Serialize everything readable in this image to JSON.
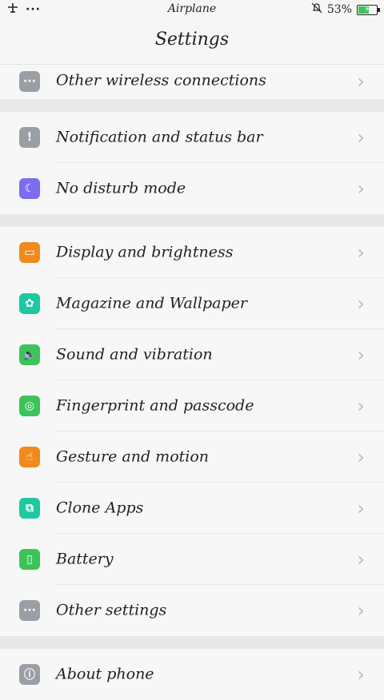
{
  "status_bar": {
    "left_icons": [
      "airplane-icon",
      "more-dots-icon"
    ],
    "center_text": "Airplane",
    "battery_percent": "53%",
    "battery_level": 0.53,
    "battery_color": "#3cc35a"
  },
  "header": {
    "title": "Settings"
  },
  "sections": [
    {
      "items": [
        {
          "label": "Other wireless connections",
          "icon": "more-dots-icon",
          "color": "#9a9fa6",
          "glyph": "···"
        }
      ]
    },
    {
      "items": [
        {
          "label": "Notification and status bar",
          "icon": "exclamation-icon",
          "color": "#9a9fa6",
          "glyph": "!"
        },
        {
          "label": "No disturb mode",
          "icon": "moon-icon",
          "color": "#7b6cf0",
          "glyph": "☾"
        }
      ]
    },
    {
      "items": [
        {
          "label": "Display and brightness",
          "icon": "monitor-icon",
          "color": "#f08a1d",
          "glyph": "▭"
        },
        {
          "label": "Magazine and Wallpaper",
          "icon": "pinwheel-icon",
          "color": "#1ec8a0",
          "glyph": "✿"
        },
        {
          "label": "Sound and vibration",
          "icon": "speaker-icon",
          "color": "#3cc35a",
          "glyph": "🔈"
        },
        {
          "label": "Fingerprint and passcode",
          "icon": "fingerprint-icon",
          "color": "#3cc35a",
          "glyph": "◎"
        },
        {
          "label": "Gesture and motion",
          "icon": "hand-icon",
          "color": "#f08a1d",
          "glyph": "☝"
        },
        {
          "label": "Clone Apps",
          "icon": "clone-icon",
          "color": "#1ec8a0",
          "glyph": "⧉"
        },
        {
          "label": "Battery",
          "icon": "battery-icon",
          "color": "#3cc35a",
          "glyph": "▯"
        },
        {
          "label": "Other settings",
          "icon": "more-dots-icon",
          "color": "#9a9fa6",
          "glyph": "···"
        }
      ]
    },
    {
      "items": [
        {
          "label": "About phone",
          "icon": "info-icon",
          "color": "#9a9fa6",
          "glyph": "ⓘ"
        }
      ]
    }
  ],
  "chevron": "›"
}
